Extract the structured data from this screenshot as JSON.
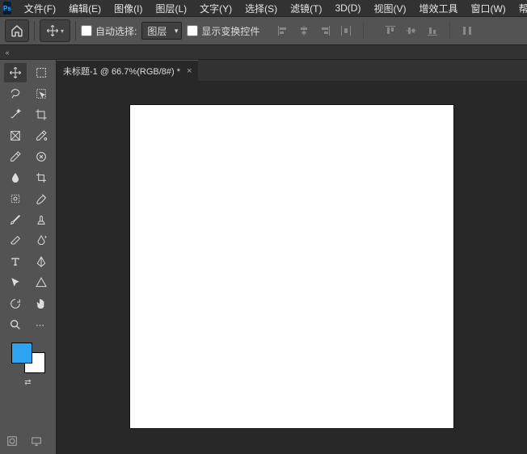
{
  "menubar": {
    "items": [
      "文件(F)",
      "编辑(E)",
      "图像(I)",
      "图层(L)",
      "文字(Y)",
      "选择(S)",
      "滤镜(T)",
      "3D(D)",
      "视图(V)",
      "增效工具",
      "窗口(W)",
      "帮助(H)"
    ]
  },
  "optionbar": {
    "auto_select_label": "自动选择:",
    "auto_select_checked": false,
    "dropdown_value": "图层",
    "show_transform_label": "显示变换控件",
    "show_transform_checked": false
  },
  "tab": {
    "title": "未标题-1 @ 66.7%(RGB/8#) *"
  },
  "colors": {
    "foreground": "#2ea3f2",
    "background": "#ffffff"
  },
  "tools": [
    [
      "move",
      "rect-marquee"
    ],
    [
      "lasso",
      "object-select"
    ],
    [
      "magic-wand",
      "crop"
    ],
    [
      "frame",
      "eyedropper-plus"
    ],
    [
      "eyedropper",
      "spot-heal"
    ],
    [
      "blur",
      "crop2"
    ],
    [
      "patch",
      "art-history"
    ],
    [
      "brush",
      "clone-stamp"
    ],
    [
      "eraser",
      "paint-bucket"
    ],
    [
      "type",
      "path"
    ],
    [
      "direct-select",
      "custom-shape"
    ],
    [
      "pan",
      "hand"
    ],
    [
      "zoom",
      "more"
    ]
  ]
}
